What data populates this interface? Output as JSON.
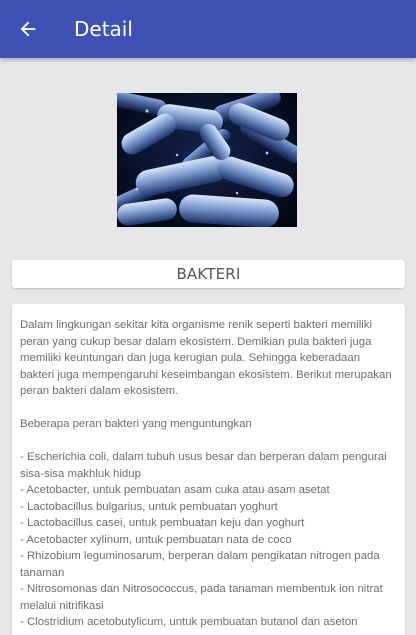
{
  "appbar": {
    "title": "Detail",
    "back_icon": "arrow-left-icon",
    "color": "#3f51b5"
  },
  "hero_image": {
    "subject": "bacteria microscope image"
  },
  "item": {
    "title": "BAKTERI",
    "description": "Dalam lingkungan sekitar kita organisme renik seperti bakteri memiliki peran yang cukup besar dalam ekosistem. Demikian pula bakteri juga memiliki keuntungan dan juga kerugian pula. Sehingga keberadaan bakteri juga mempengaruhi keseimbangan ekosistem. Berikut merupakan peran bakteri dalam ekosistem.\n\nBeberapa peran bakteri yang menguntungkan\n\n- Escherichia coli, dalam tubuh usus besar dan berperan dalam pengurai sisa-sisa makhluk hidup\n- Acetobacter, untuk pembuatan asam cuka atau asam asetat\n- Lactobacillus bulgarius, untuk pembuatan yoghurt\n- Lactobacillus casei, untuk pembuatan keju dan yoghurt\n- Acetobacter xylinum, untuk pembuatan nata de coco\n- Rhizobium leguminosarum, berperan dalam pengikatan nitrogen pada tanaman\n- Nitrosomonas dan Nitrosococcus, pada tanaman membentuk ion nitrat melalui nitrifikasi\n- Clostridium acetobutylicum, untuk pembuatan butanol dan aseton"
  }
}
